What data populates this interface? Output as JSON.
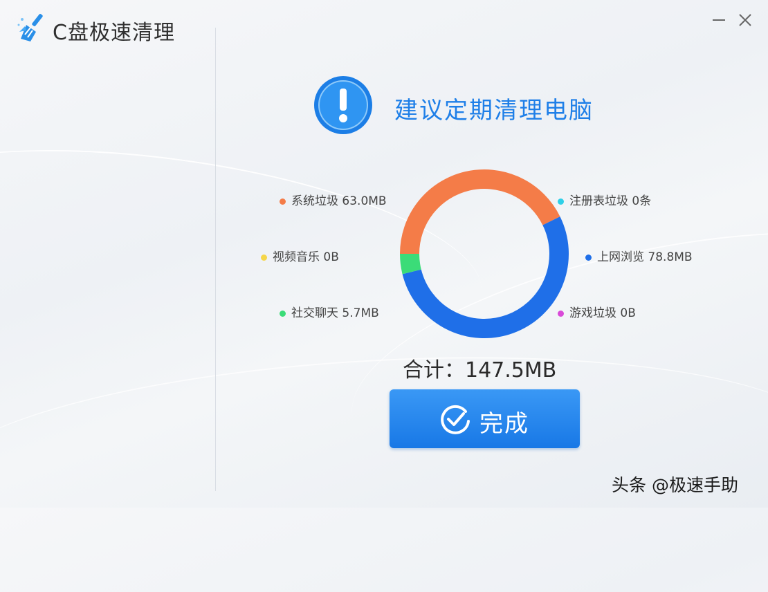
{
  "window": {
    "title": "C盘极速清理",
    "minimize_icon": "minimize-icon",
    "close_icon": "close-icon"
  },
  "headline": {
    "icon": "exclamation-icon",
    "text": "建议定期清理电脑"
  },
  "chart_data": {
    "type": "pie",
    "categories": [
      "系统垃圾",
      "注册表垃圾",
      "视频音乐",
      "上网浏览",
      "社交聊天",
      "游戏垃圾"
    ],
    "values_mb": [
      63.0,
      0,
      0,
      78.8,
      5.7,
      0
    ],
    "total_mb": 147.5,
    "colors": [
      "#f47c48",
      "#2fd0e8",
      "#f5d64a",
      "#1f6fe8",
      "#3bdc78",
      "#d94ad8"
    ]
  },
  "legend": [
    {
      "label": "系统垃圾 63.0MB",
      "color": "#f47c48"
    },
    {
      "label": "视频音乐 0B",
      "color": "#f5d64a"
    },
    {
      "label": "社交聊天 5.7MB",
      "color": "#3bdc78"
    },
    {
      "label": "注册表垃圾 0条",
      "color": "#2fd0e8"
    },
    {
      "label": "上网浏览 78.8MB",
      "color": "#1f6fe8"
    },
    {
      "label": "游戏垃圾 0B",
      "color": "#d94ad8"
    }
  ],
  "total": {
    "text": "合计：147.5MB"
  },
  "done_button": {
    "label": "完成",
    "icon": "check-circle-icon"
  },
  "watermark": {
    "text": "头条 @极速手助"
  },
  "colors": {
    "accent": "#1e7fe8",
    "button": "#2389ee"
  }
}
